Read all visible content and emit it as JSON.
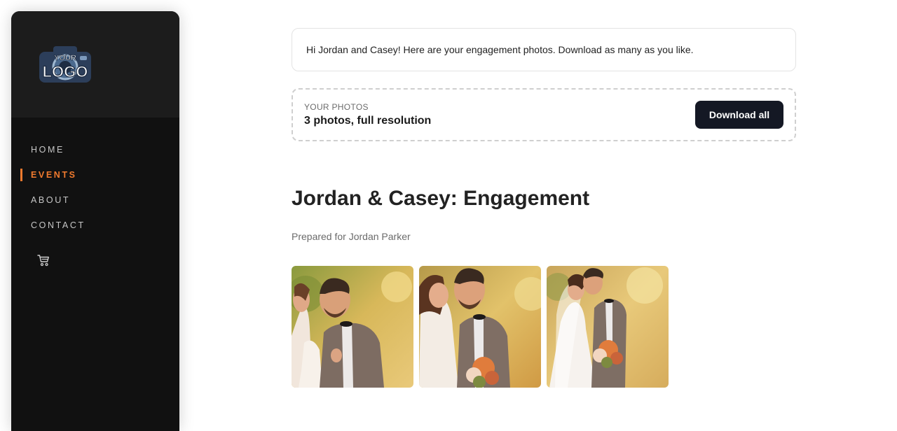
{
  "sidebar": {
    "logo": {
      "top_text": "YOUR",
      "main_text": "LOGO"
    },
    "nav": [
      {
        "label": "HOME",
        "active": false
      },
      {
        "label": "EVENTS",
        "active": true
      },
      {
        "label": "ABOUT",
        "active": false
      },
      {
        "label": "CONTACT",
        "active": false
      }
    ],
    "cart_icon": "shopping-cart-icon",
    "colors": {
      "background": "#111111",
      "logo_band": "#1c1c1c",
      "accent": "#f07a2e"
    }
  },
  "main": {
    "greeting": "Hi Jordan and Casey! Here are your engagement photos. Download as many as you like.",
    "photos_box": {
      "label": "YOUR PHOTOS",
      "summary": "3 photos, full resolution",
      "download_label": "Download all"
    },
    "event_title": "Jordan & Casey: Engagement",
    "prepared_for": "Prepared for Jordan Parker",
    "photos": [
      {
        "name": "photo-1"
      },
      {
        "name": "photo-2"
      },
      {
        "name": "photo-3"
      }
    ],
    "colors": {
      "button": "#141824"
    }
  }
}
